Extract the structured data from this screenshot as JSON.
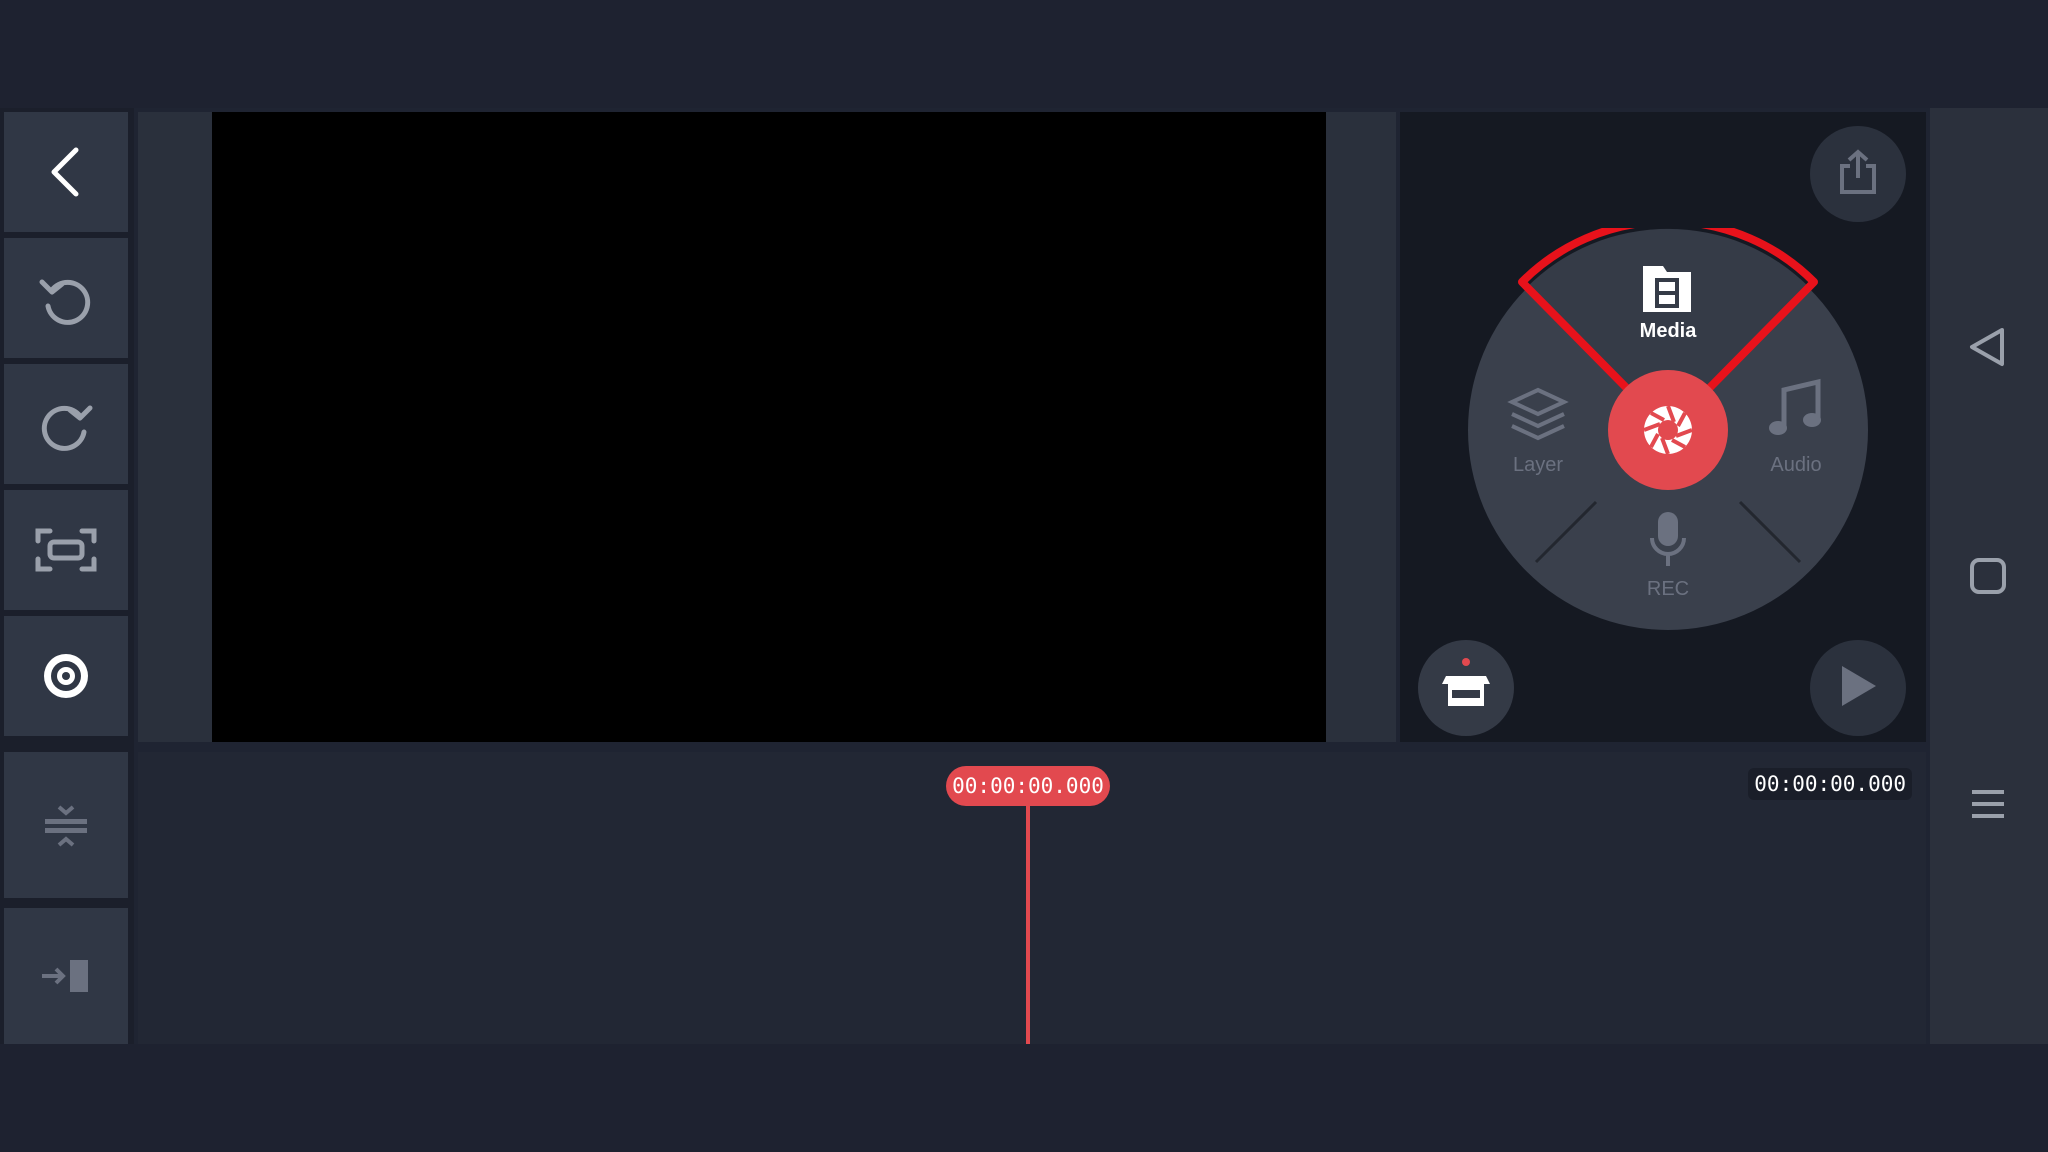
{
  "wheel": {
    "media_label": "Media",
    "layer_label": "Layer",
    "audio_label": "Audio",
    "rec_label": "REC"
  },
  "timeline": {
    "current_time": "00:00:00.000",
    "total_duration": "00:00:00.000"
  },
  "icons": {
    "back": "chevron-left-icon",
    "undo": "undo-icon",
    "redo": "redo-icon",
    "fullscreen": "fullscreen-icon",
    "settings": "settings-icon",
    "layers_adjust": "timeline-adjust-icon",
    "jump_end": "jump-to-end-icon",
    "share": "share-icon",
    "store": "store-icon",
    "play": "play-icon",
    "capture": "shutter-icon",
    "nav_back": "nav-back-icon",
    "nav_home": "nav-home-icon",
    "nav_recents": "nav-recents-icon"
  },
  "colors": {
    "accent": "#e2494f",
    "highlight_ring": "#e8121b",
    "background": "#1f2432",
    "panel": "#303745"
  }
}
